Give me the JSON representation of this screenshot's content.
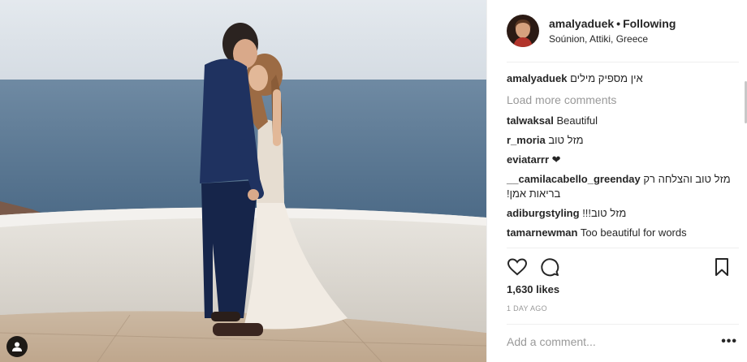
{
  "post": {
    "username": "amalyaduek",
    "follow_label": "Following",
    "separator": "•",
    "location": "Soúnion, Attiki, Greece",
    "caption_user": "amalyaduek",
    "caption_text": "אין מספיק מילים",
    "load_more": "Load more comments",
    "comments": [
      {
        "user": "talwaksal",
        "text": "Beautiful"
      },
      {
        "user": "r_moria",
        "text": "מזל טוב"
      },
      {
        "user": "eviatarrr",
        "text": "❤"
      },
      {
        "user": "__camilacabello_greenday",
        "text": "מזל טוב והצלחה רק בריאות אמן!"
      },
      {
        "user": "adiburgstyling",
        "text": "מזל טוב!!!"
      },
      {
        "user": "tamarnewman",
        "text": "Too beautiful for words"
      }
    ],
    "likes": "1,630 likes",
    "time_ago": "1 DAY AGO",
    "add_comment_placeholder": "Add a comment...",
    "more_label": "•••"
  },
  "icons": {
    "like": "heart-icon",
    "comment": "comment-icon",
    "save": "bookmark-icon",
    "tagged": "person-tag-icon"
  },
  "colors": {
    "text": "#262626",
    "muted": "#999999",
    "divider": "#efefef"
  }
}
